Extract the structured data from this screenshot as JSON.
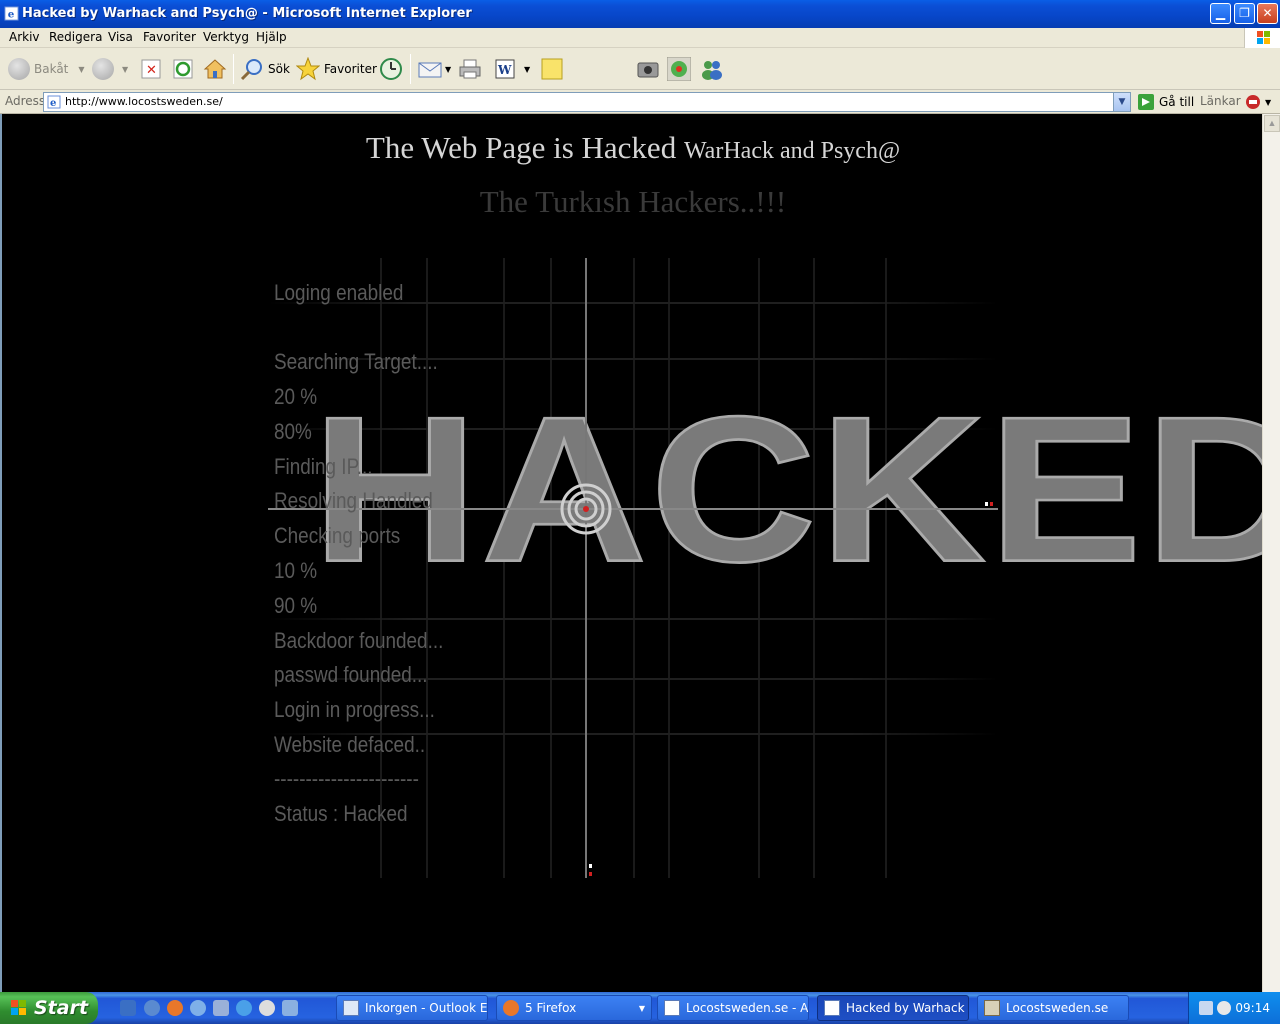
{
  "window": {
    "title": "Hacked by Warhack and Psych@ - Microsoft Internet Explorer"
  },
  "menu": [
    "Arkiv",
    "Redigera",
    "Visa",
    "Favoriter",
    "Verktyg",
    "Hjälp"
  ],
  "toolbar": {
    "back": "Bakåt",
    "search": "Sök",
    "favorites": "Favoriter"
  },
  "address": {
    "label": "Adress",
    "url": "http://www.locostsweden.se/",
    "go": "Gå till",
    "links": "Länkar"
  },
  "page": {
    "headline_main": "The Web Page is Hacked",
    "headline_small": "WarHack and Psych@",
    "subheadline": "The Turkısh Hackers..!!!",
    "big_word": "HACKED",
    "log": [
      "Loging enabled",
      "",
      "Searching Target....",
      "20 %",
      "80%",
      "Finding IP...",
      "Resolving Handled",
      "Checking ports",
      "10 %",
      "90 %",
      "Backdoor founded...",
      "passwd founded...",
      "Login in progress...",
      "Website defaced..",
      "-----------------------",
      "Status : Hacked"
    ]
  },
  "taskbar": {
    "start": "Start",
    "tasks": [
      "Inkorgen - Outlook E...",
      "5 Firefox",
      "Locostsweden.se - A...",
      "Hacked by Warhack a...",
      "Locostsweden.se"
    ],
    "clock": "09:14"
  }
}
